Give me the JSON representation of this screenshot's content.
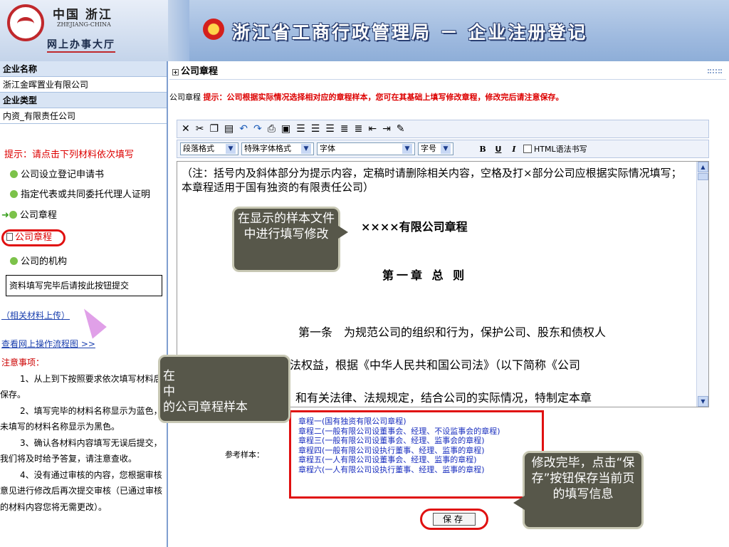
{
  "header": {
    "logo_line1": "中国 浙江",
    "logo_line2": "ZHEJIANG-CHINA",
    "logo_line3": "网上办事大厅",
    "banner": "浙江省工商行政管理局 － 企业注册登记"
  },
  "sidebar": {
    "company_name_label": "企业名称",
    "company_name_value": "浙江金晖置业有限公司",
    "company_type_label": "企业类型",
    "company_type_value": "内资_有限责任公司",
    "tip": "提示：请点击下列材料依次填写",
    "items": [
      {
        "label": "公司设立登记申请书"
      },
      {
        "label": "指定代表或共同委托代理人证明"
      },
      {
        "label": "公司章程"
      },
      {
        "label": "公司章程"
      },
      {
        "label": "公司的机构"
      }
    ],
    "submit_hint": "资料填写完毕后请按此按钮提交",
    "related_upload": "（相关材料上传）",
    "flow_link": "查看网上操作流程图 >>",
    "notes_title": "注意事项：",
    "notes": [
      "1、从上到下按照要求依次填写材料后保存。",
      "2、填写完毕的材料名称显示为蓝色，未填写的材料名称显示为黑色。",
      "3、确认各材料内容填写无误后提交，我们将及时给予答复，请注意查收。",
      "4、没有通过审核的内容，您根据审核意见进行修改后再次提交审核（已通过审核的材料内容您将无需更改）。"
    ]
  },
  "main": {
    "panel_title": "公司章程",
    "hint_prefix": "公司章程",
    "hint_text": "提示：公司根据实际情况选择相对应的章程样本，您可在其基础上填写修改章程，修改完后请注意保存。",
    "toolbar_icons": [
      "cut-icon",
      "copy-icon",
      "paste-icon",
      "paste-text-icon",
      "undo-icon",
      "redo-icon",
      "print-icon",
      "save-icon",
      "align-left-icon",
      "align-center-icon",
      "align-right-icon",
      "ordered-list-icon",
      "unordered-list-icon",
      "outdent-icon",
      "indent-icon",
      "clear-format-icon"
    ],
    "format_selects": {
      "paragraph": "段落格式",
      "special": "特殊字体格式",
      "font": "字体",
      "size": "字号"
    },
    "bold": "B",
    "underline": "U",
    "italic": "I",
    "html_mode": "HTML语法书写",
    "editor": {
      "note": "（注：括号内及斜体部分为提示内容，定稿时请删除相关内容，空格及打×部分公司应根据实际情况填写；本章程适用于国有独资的有限责任公司）",
      "doc_title": "××××有限公司章程",
      "chapter": "第一章 总 则",
      "art1_line1": "第一条　为规范公司的组织和行为，保护公司、股东和债权人",
      "art1_line2": "的合法权益，根据《中华人民共和国公司法》（以下简称《公司",
      "art1_line3": "法》）和有关法律、法规规定，结合公司的实际情况，特制定本章"
    },
    "sample_label": "参考样本：",
    "samples": [
      "章程一(国有独资有限公司章程)",
      "章程二(一般有限公司设董事会、经理、不设监事会的章程)",
      "章程三(一般有限公司设董事会、经理、监事会的章程)",
      "章程四(一般有限公司设执行董事、经理、监事的章程)",
      "章程五(一人有限公司设董事会、经理、监事的章程)",
      "章程六(一人有限公司设执行董事、经理、监事的章程)"
    ],
    "save_button": "保存"
  },
  "callouts": {
    "c1": "在显示的样本文件中进行填写修改",
    "c2_line1": "在",
    "c2_line2": "中",
    "c2_line3": "的公司章程样本",
    "c3": "修改完毕，点击“保存”按钮保存当前页的填写信息"
  }
}
